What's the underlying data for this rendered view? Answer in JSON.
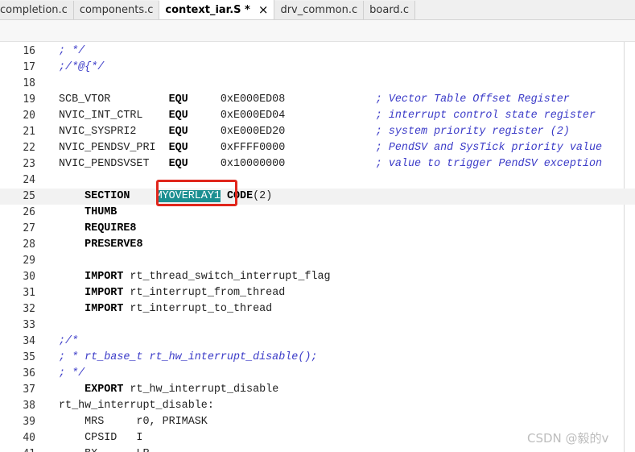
{
  "tabs": [
    {
      "label": "completion.c",
      "active": false
    },
    {
      "label": "components.c",
      "active": false
    },
    {
      "label": "context_iar.S *",
      "active": true
    },
    {
      "label": "drv_common.c",
      "active": false
    },
    {
      "label": "board.c",
      "active": false
    }
  ],
  "close_glyph": "×",
  "lines": [
    {
      "num": "16",
      "segments": [
        {
          "t": "; */",
          "c": "cmt"
        }
      ]
    },
    {
      "num": "17",
      "segments": [
        {
          "t": ";/*@{*/",
          "c": "cmt"
        }
      ]
    },
    {
      "num": "18",
      "segments": []
    },
    {
      "num": "19",
      "segments": [
        {
          "t": "SCB_VTOR         ",
          "c": ""
        },
        {
          "t": "EQU",
          "c": "kw"
        },
        {
          "t": "     0xE000ED08              ",
          "c": ""
        },
        {
          "t": "; Vector Table Offset Register",
          "c": "cmt"
        }
      ]
    },
    {
      "num": "20",
      "segments": [
        {
          "t": "NVIC_INT_CTRL    ",
          "c": ""
        },
        {
          "t": "EQU",
          "c": "kw"
        },
        {
          "t": "     0xE000ED04              ",
          "c": ""
        },
        {
          "t": "; interrupt control state register",
          "c": "cmt"
        }
      ]
    },
    {
      "num": "21",
      "segments": [
        {
          "t": "NVIC_SYSPRI2     ",
          "c": ""
        },
        {
          "t": "EQU",
          "c": "kw"
        },
        {
          "t": "     0xE000ED20              ",
          "c": ""
        },
        {
          "t": "; system priority register (2)",
          "c": "cmt"
        }
      ]
    },
    {
      "num": "22",
      "segments": [
        {
          "t": "NVIC_PENDSV_PRI  ",
          "c": ""
        },
        {
          "t": "EQU",
          "c": "kw"
        },
        {
          "t": "     0xFFFF0000              ",
          "c": ""
        },
        {
          "t": "; PendSV and SysTick priority value",
          "c": "cmt"
        }
      ]
    },
    {
      "num": "23",
      "segments": [
        {
          "t": "NVIC_PENDSVSET   ",
          "c": ""
        },
        {
          "t": "EQU",
          "c": "kw"
        },
        {
          "t": "     0x10000000              ",
          "c": ""
        },
        {
          "t": "; value to trigger PendSV exception",
          "c": "cmt"
        }
      ]
    },
    {
      "num": "24",
      "segments": []
    },
    {
      "num": "25",
      "current": true,
      "segments": [
        {
          "t": "    ",
          "c": ""
        },
        {
          "t": "SECTION",
          "c": "kw"
        },
        {
          "t": "    ",
          "c": ""
        },
        {
          "t": "MYOVERLAY1",
          "c": "sel"
        },
        {
          "t": " ",
          "c": ""
        },
        {
          "t": "CODE",
          "c": "kw"
        },
        {
          "t": "(2)",
          "c": ""
        }
      ]
    },
    {
      "num": "26",
      "segments": [
        {
          "t": "    ",
          "c": ""
        },
        {
          "t": "THUMB",
          "c": "kw"
        }
      ]
    },
    {
      "num": "27",
      "segments": [
        {
          "t": "    ",
          "c": ""
        },
        {
          "t": "REQUIRE8",
          "c": "kw"
        }
      ]
    },
    {
      "num": "28",
      "segments": [
        {
          "t": "    ",
          "c": ""
        },
        {
          "t": "PRESERVE8",
          "c": "kw"
        }
      ]
    },
    {
      "num": "29",
      "segments": []
    },
    {
      "num": "30",
      "segments": [
        {
          "t": "    ",
          "c": ""
        },
        {
          "t": "IMPORT",
          "c": "kw"
        },
        {
          "t": " rt_thread_switch_interrupt_flag",
          "c": ""
        }
      ]
    },
    {
      "num": "31",
      "segments": [
        {
          "t": "    ",
          "c": ""
        },
        {
          "t": "IMPORT",
          "c": "kw"
        },
        {
          "t": " rt_interrupt_from_thread",
          "c": ""
        }
      ]
    },
    {
      "num": "32",
      "segments": [
        {
          "t": "    ",
          "c": ""
        },
        {
          "t": "IMPORT",
          "c": "kw"
        },
        {
          "t": " rt_interrupt_to_thread",
          "c": ""
        }
      ]
    },
    {
      "num": "33",
      "segments": []
    },
    {
      "num": "34",
      "segments": [
        {
          "t": ";/*",
          "c": "cmt"
        }
      ]
    },
    {
      "num": "35",
      "segments": [
        {
          "t": "; * rt_base_t rt_hw_interrupt_disable();",
          "c": "cmt"
        }
      ]
    },
    {
      "num": "36",
      "segments": [
        {
          "t": "; */",
          "c": "cmt"
        }
      ]
    },
    {
      "num": "37",
      "segments": [
        {
          "t": "    ",
          "c": ""
        },
        {
          "t": "EXPORT",
          "c": "kw"
        },
        {
          "t": " rt_hw_interrupt_disable",
          "c": ""
        }
      ]
    },
    {
      "num": "38",
      "segments": [
        {
          "t": "rt_hw_interrupt_disable:",
          "c": ""
        }
      ]
    },
    {
      "num": "39",
      "segments": [
        {
          "t": "    MRS     r0, PRIMASK",
          "c": ""
        }
      ]
    },
    {
      "num": "40",
      "segments": [
        {
          "t": "    CPSID   I",
          "c": ""
        }
      ]
    },
    {
      "num": "41",
      "segments": [
        {
          "t": "    BX      LR",
          "c": ""
        }
      ]
    }
  ],
  "watermark": "CSDN @毅的v",
  "colors": {
    "comment": "#3c3cc8",
    "selection": "#1b8f91",
    "highlight_box": "#e0261c",
    "current_line": "#f2f2f2"
  }
}
